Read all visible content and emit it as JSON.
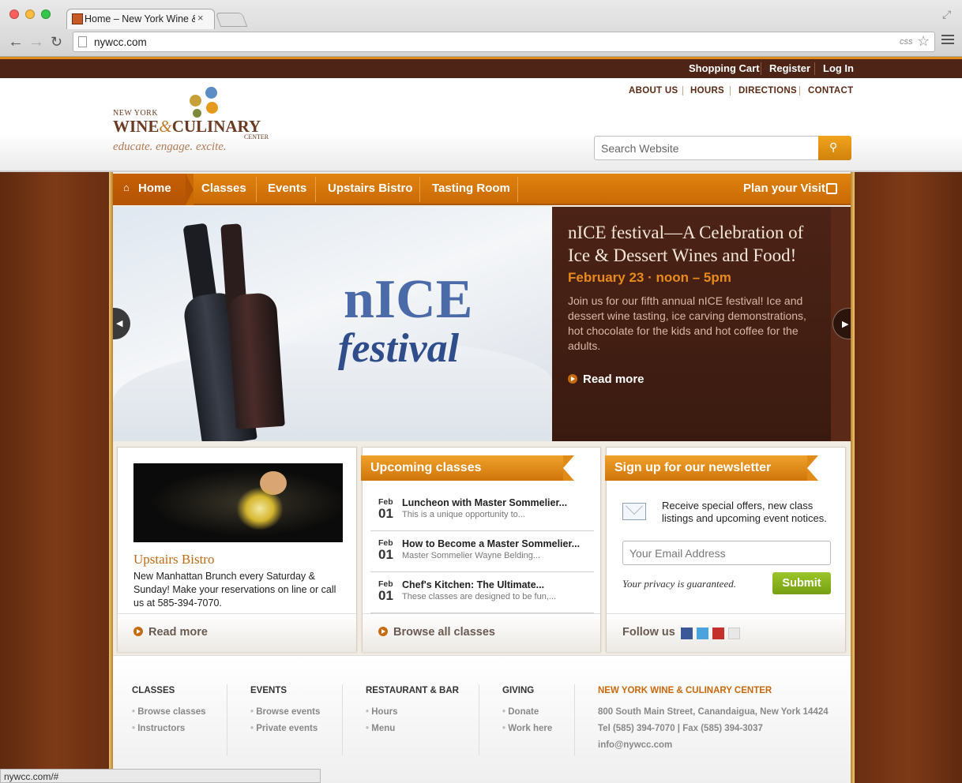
{
  "browser": {
    "tab_title": "Home – New York Wine & Culinary Center",
    "url": "nywcc.com",
    "css_badge": "css",
    "status_url": "nywcc.com/#"
  },
  "util_nav": [
    "Shopping Cart",
    "Register",
    "Log In"
  ],
  "top_links": [
    "ABOUT US",
    "HOURS",
    "DIRECTIONS",
    "CONTACT"
  ],
  "logo": {
    "line1": "NEW YORK",
    "wine": "WINE",
    "amp": "&",
    "culinary": "CULINARY",
    "center": "CENTER",
    "tagline": "educate. engage. excite."
  },
  "search": {
    "placeholder": "Search Website"
  },
  "main_nav": {
    "items": [
      "Home",
      "Classes",
      "Events",
      "Upstairs Bistro",
      "Tasting Room"
    ],
    "plan": "Plan your Visit"
  },
  "hero": {
    "image_text_1": "nICE",
    "image_text_2": "festival",
    "title": "nICE festival—A Celebration of Ice & Dessert Wines and Food!",
    "date": "February 23 · noon – 5pm",
    "body": "Join us for our fifth annual nICE festival! Ice and dessert wine tasting, ice carving demonstrations, hot chocolate for the kids and hot coffee for the adults.",
    "more": "Read more"
  },
  "bistro": {
    "title": "Upstairs Bistro",
    "body": "New Manhattan Brunch every Saturday & Sunday! Make your reservations on line or call us at 585-394-7070.",
    "more": "Read more"
  },
  "classes": {
    "heading": "Upcoming classes",
    "items": [
      {
        "month": "Feb",
        "day": "01",
        "title": "Luncheon with Master Sommelier...",
        "desc": "This is a unique opportunity to..."
      },
      {
        "month": "Feb",
        "day": "01",
        "title": "How to Become a Master Sommelier...",
        "desc": "Master Sommelier Wayne Belding..."
      },
      {
        "month": "Feb",
        "day": "01",
        "title": "Chef's Kitchen: The Ultimate...",
        "desc": "These classes are designed to be fun,..."
      }
    ],
    "browse": "Browse all classes"
  },
  "newsletter": {
    "heading": "Sign up for our newsletter",
    "body": "Receive special offers, new class listings and upcoming event notices.",
    "email_placeholder": "Your Email Address",
    "privacy": "Your privacy is guaranteed.",
    "submit": "Submit",
    "follow": "Follow us"
  },
  "footer": {
    "columns": [
      {
        "heading": "CLASSES",
        "links": [
          "Browse classes",
          "Instructors"
        ]
      },
      {
        "heading": "EVENTS",
        "links": [
          "Browse events",
          "Private events"
        ]
      },
      {
        "heading": "RESTAURANT & BAR",
        "links": [
          "Hours",
          "Menu"
        ]
      },
      {
        "heading": "GIVING",
        "links": [
          "Donate",
          "Work here"
        ]
      }
    ],
    "org_name": "NEW YORK WINE & CULINARY CENTER",
    "address": "800 South Main Street, Canandaigua, New York 14424",
    "phone": "Tel (585) 394-7070 | Fax (585) 394-3037",
    "email": "info@nywcc.com"
  },
  "colors": {
    "brand_brown": "#4e2416",
    "accent_orange": "#e08a18",
    "submit_green": "#8ab51e"
  }
}
